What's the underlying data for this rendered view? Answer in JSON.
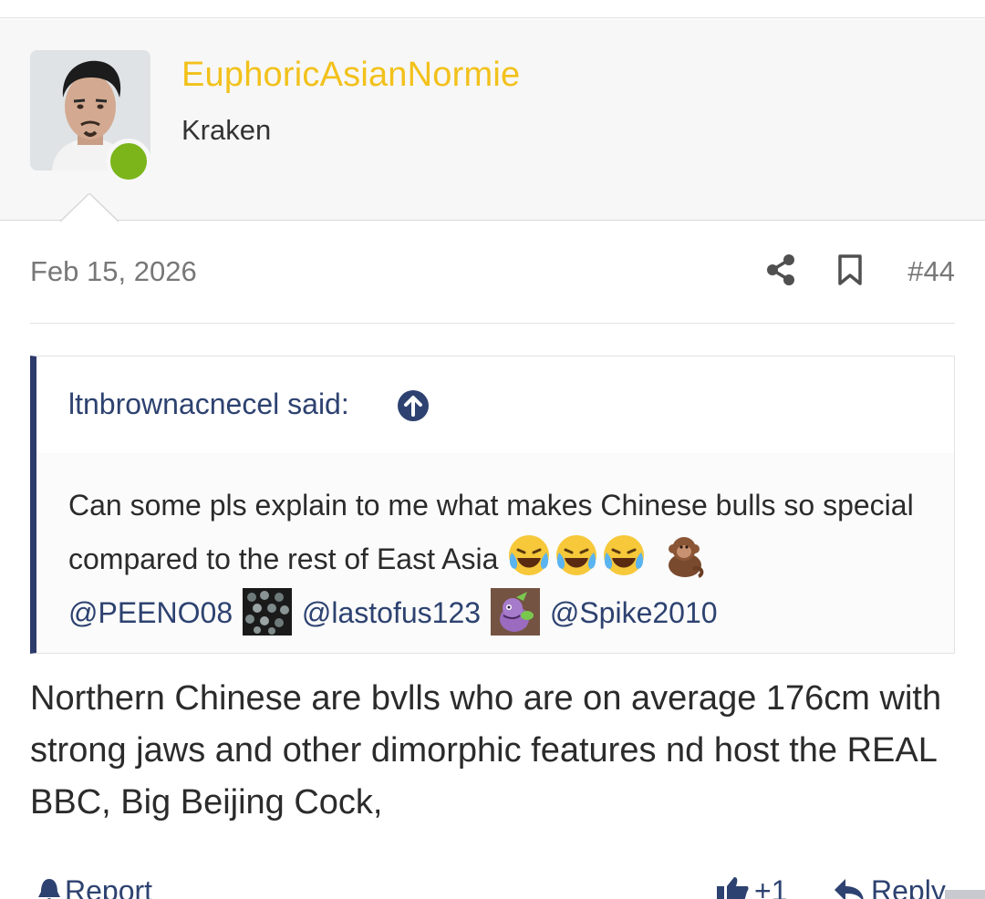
{
  "user": {
    "username": "EuphoricAsianNormie",
    "title": "Kraken",
    "online": true,
    "username_color": "#f2c11b",
    "online_color": "#7bb51a"
  },
  "post": {
    "date": "Feb 15, 2026",
    "number": "#44",
    "icons": [
      "share-icon",
      "bookmark-icon"
    ],
    "body": "Northern Chinese are bvlls who are on average 176cm with strong jaws and other dimorphic features nd host the REAL BBC, Big Beijing Cock,"
  },
  "quote": {
    "author_label": "ltnbrownacnecel said:",
    "text": "Can some pls explain to me what makes Chinese bulls so special compared to the rest of East Asia",
    "emojis": [
      "crying-laughing-emoji",
      "crying-laughing-emoji",
      "crying-laughing-emoji",
      "monkey-emoji"
    ],
    "mentions": [
      "@PEENO08",
      "@lastofus123",
      "@Spike2010"
    ]
  },
  "footer": {
    "report_label": "Report",
    "like_label": "+1",
    "reply_label": "Reply"
  },
  "colors": {
    "accent": "#2d4270",
    "quote_border": "#2d3b6b"
  }
}
